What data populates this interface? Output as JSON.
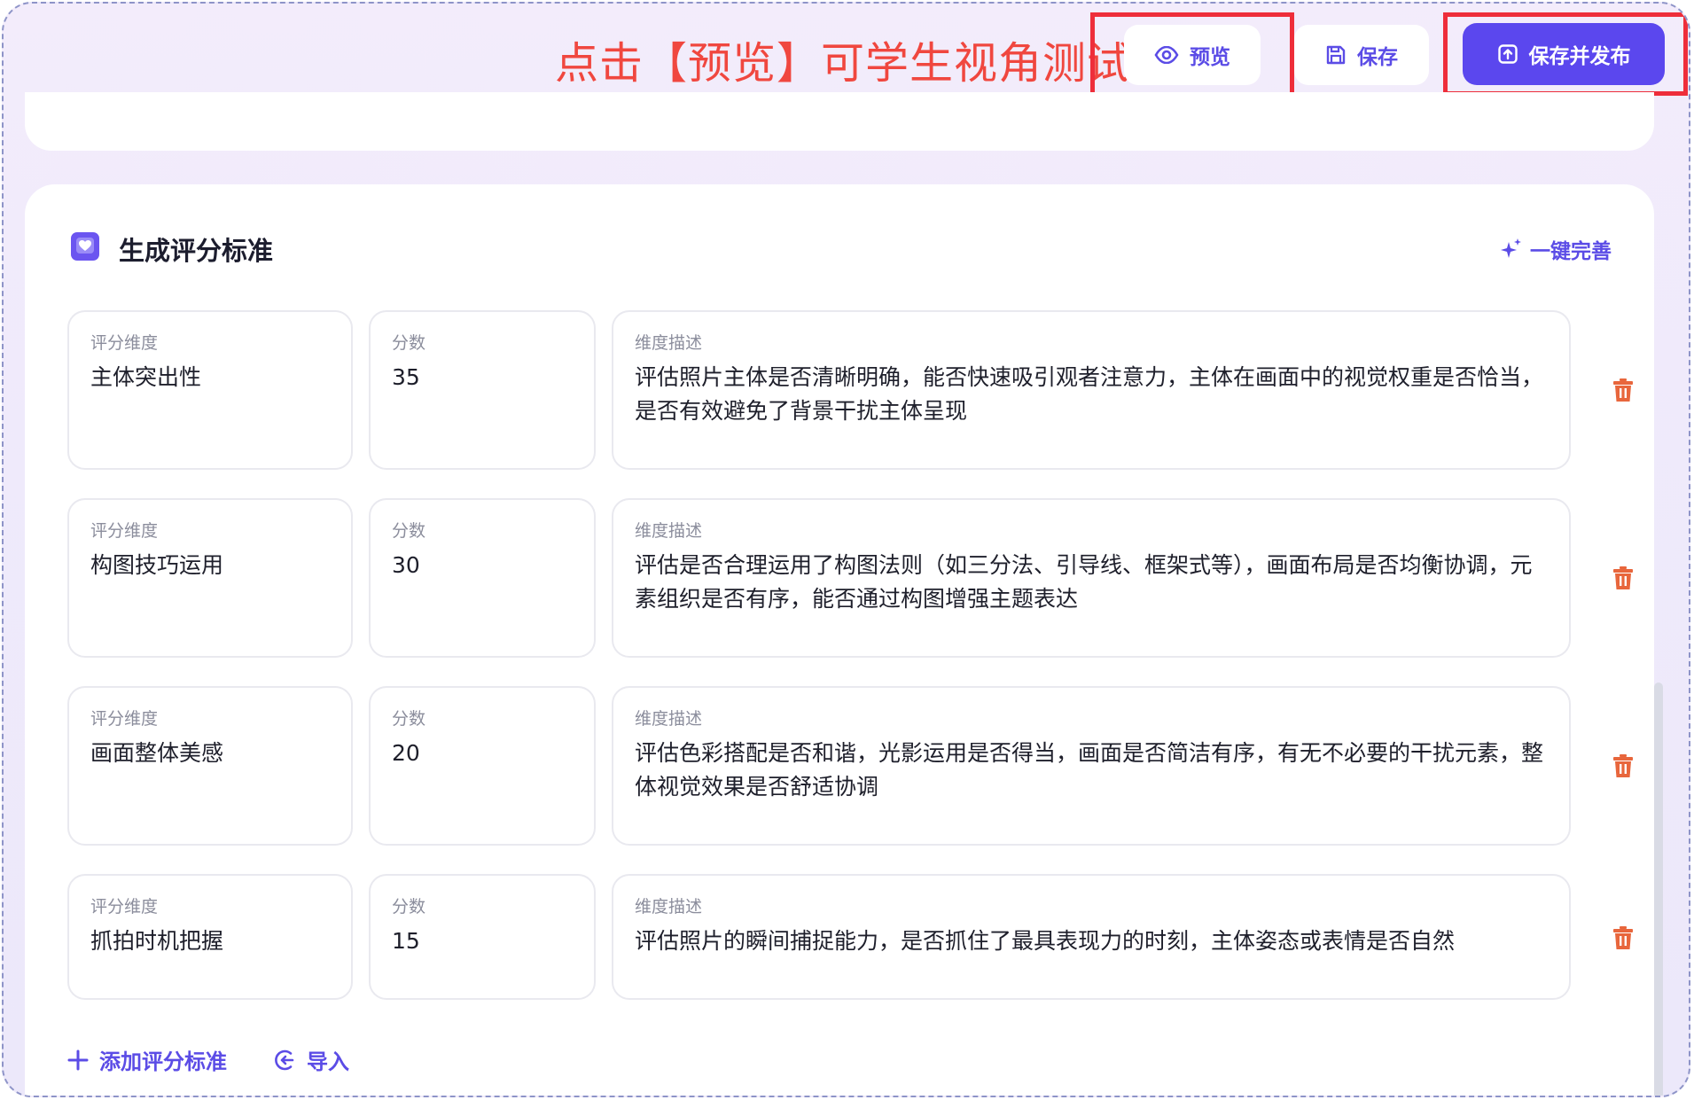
{
  "header": {
    "annotation": "点击【预览】可学生视角测试",
    "preview_label": "预览",
    "save_label": "保存",
    "publish_label": "保存并发布"
  },
  "section": {
    "title": "生成评分标准",
    "auto_complete_label": "一键完善"
  },
  "field_labels": {
    "dimension": "评分维度",
    "score": "分数",
    "description": "维度描述"
  },
  "criteria": [
    {
      "dimension": "主体突出性",
      "score": "35",
      "description": "评估照片主体是否清晰明确，能否快速吸引观者注意力，主体在画面中的视觉权重是否恰当，是否有效避免了背景干扰主体呈现"
    },
    {
      "dimension": "构图技巧运用",
      "score": "30",
      "description": "评估是否合理运用了构图法则（如三分法、引导线、框架式等），画面布局是否均衡协调，元素组织是否有序，能否通过构图增强主题表达"
    },
    {
      "dimension": "画面整体美感",
      "score": "20",
      "description": "评估色彩搭配是否和谐，光影运用是否得当，画面是否简洁有序，有无不必要的干扰元素，整体视觉效果是否舒适协调"
    },
    {
      "dimension": "抓拍时机把握",
      "score": "15",
      "description": "评估照片的瞬间捕捉能力，是否抓住了最具表现力的时刻，主体姿态或表情是否自然"
    }
  ],
  "footer": {
    "add_label": "添加评分标准",
    "import_label": "导入"
  },
  "colors": {
    "accent": "#5b4ce6",
    "publish_bg": "#5b47ee",
    "highlight": "#ee2e3a",
    "annotation": "#f0473f",
    "trash": "#e8663c"
  }
}
